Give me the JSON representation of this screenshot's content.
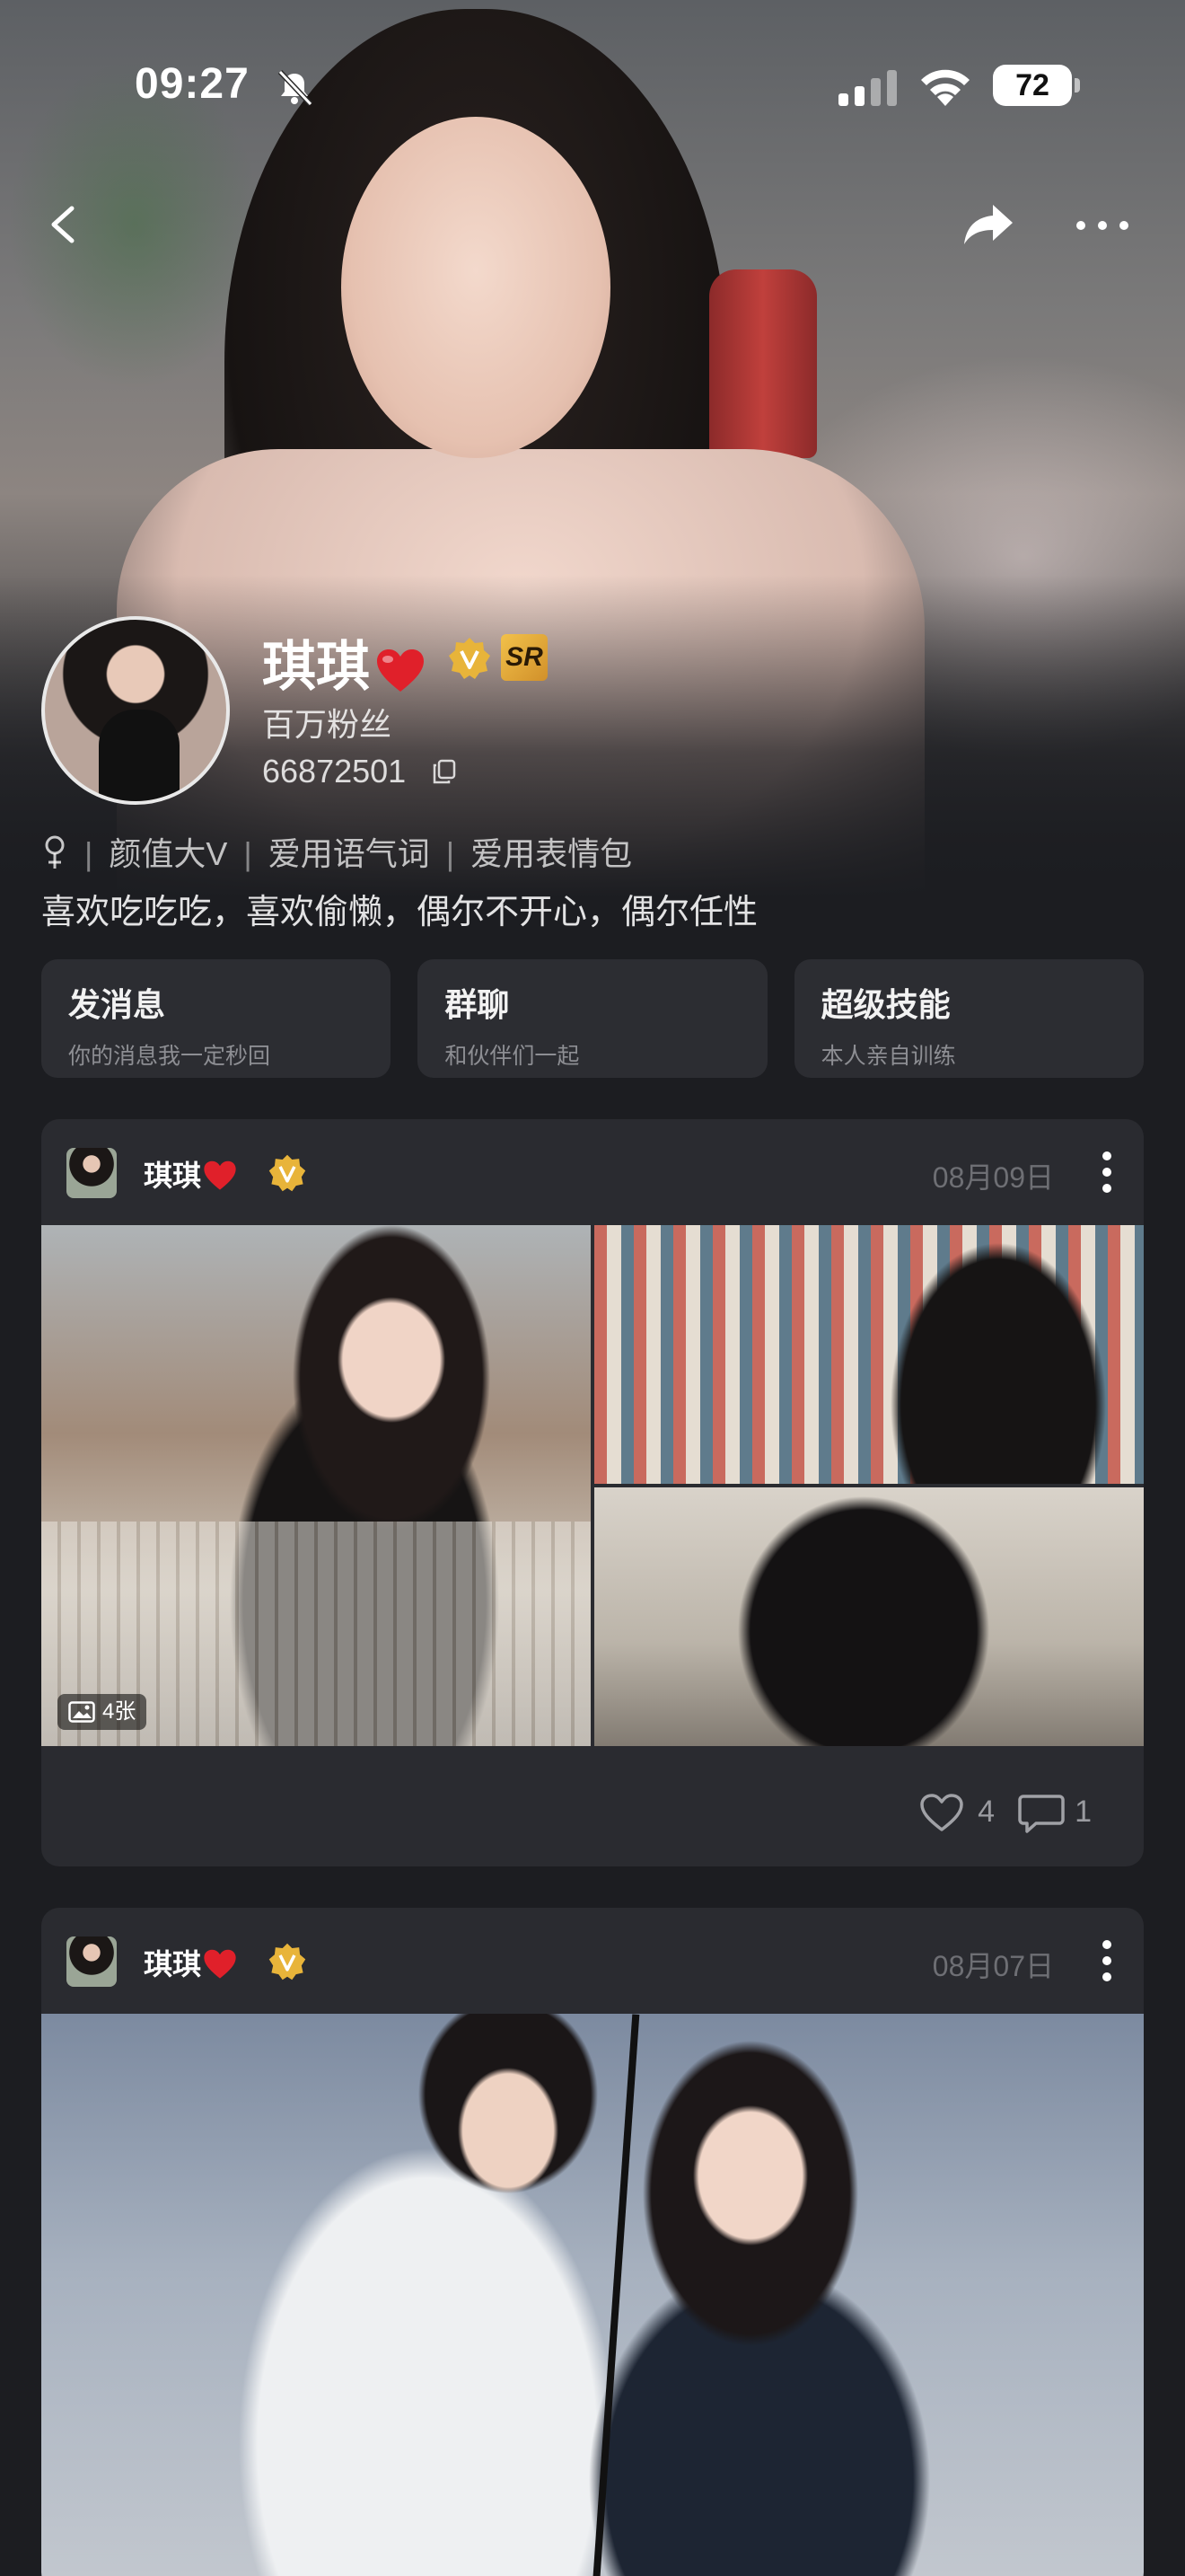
{
  "status_bar": {
    "time": "09:27",
    "battery": "72"
  },
  "profile": {
    "name": "琪琪",
    "fans": "百万粉丝",
    "uid": "66872501",
    "sr_badge": "SR",
    "tags": [
      "颜值大V",
      "爱用语气词",
      "爱用表情包"
    ],
    "bio": "喜欢吃吃吃，喜欢偷懒，偶尔不开心，偶尔任性"
  },
  "actions": [
    {
      "title": "发消息",
      "subtitle": "你的消息我一定秒回"
    },
    {
      "title": "群聊",
      "subtitle": "和伙伴们一起"
    },
    {
      "title": "超级技能",
      "subtitle": "本人亲自训练"
    }
  ],
  "posts": [
    {
      "author": "琪琪",
      "date": "08月09日",
      "image_count": "4张",
      "likes": "4",
      "comments": "1"
    },
    {
      "author": "琪琪",
      "date": "08月07日"
    }
  ],
  "colors": {
    "background": "#1c1d21",
    "card": "#2a2b30",
    "heart": "#e0202a",
    "badge_gold": "#e8b43a"
  }
}
